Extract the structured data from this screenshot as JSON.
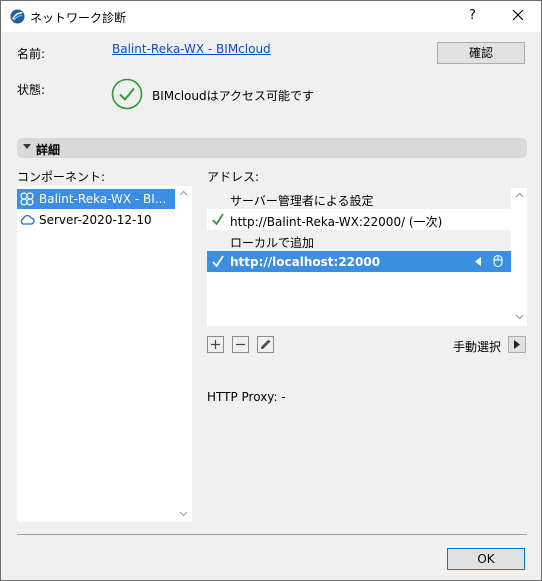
{
  "window": {
    "title": "ネットワーク診断",
    "help": "?",
    "close": "✕"
  },
  "info": {
    "name_label": "名前:",
    "name_value": "Balint-Reka-WX - BIMcloud",
    "status_label": "状態:",
    "status_value": "BIMcloudはアクセス可能です",
    "confirm_button": "確認"
  },
  "details": {
    "header": "詳細",
    "components_label": "コンポーネント:",
    "components": [
      {
        "label": "Balint-Reka-WX - BI...",
        "icon": "network-icon",
        "selected": true
      },
      {
        "label": "Server-2020-12-10",
        "icon": "cloud-icon",
        "selected": false
      }
    ],
    "address_label": "アドレス:",
    "address_rows": [
      {
        "type": "group",
        "label": "サーバー管理者による設定"
      },
      {
        "type": "item",
        "label": "http://Balint-Reka-WX:22000/ (一次)",
        "checked": true
      },
      {
        "type": "group",
        "label": "ローカルで追加"
      },
      {
        "type": "item",
        "label": "http://localhost:22000",
        "checked": true,
        "selected": true
      }
    ],
    "manual_select": "手動選択",
    "proxy": "HTTP Proxy: -"
  },
  "footer": {
    "ok_button": "OK"
  },
  "colors": {
    "selection": "#3c8ee0",
    "check_green": "#2d9b3a",
    "link": "#0a50c8"
  }
}
